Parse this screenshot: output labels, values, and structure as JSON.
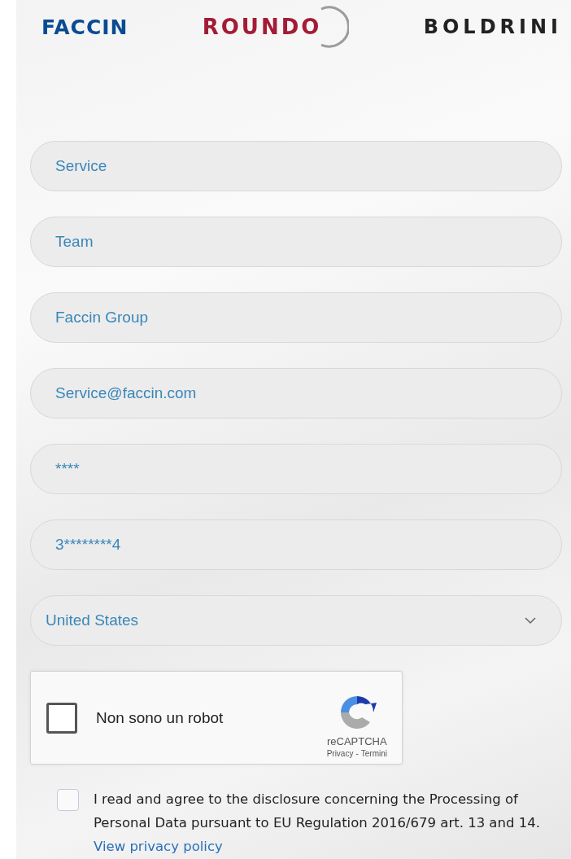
{
  "header": {
    "logos": [
      "FACCIN",
      "ROUNDO",
      "BOLDRINI"
    ]
  },
  "fields": [
    {
      "kind": "text",
      "value": "Service"
    },
    {
      "kind": "text",
      "value": "Team"
    },
    {
      "kind": "text",
      "value": "Faccin Group"
    },
    {
      "kind": "text",
      "value": "Service@faccin.com"
    },
    {
      "kind": "text",
      "value": "****"
    },
    {
      "kind": "text",
      "value": "3********4"
    },
    {
      "kind": "select",
      "value": "United States"
    }
  ],
  "captcha": {
    "label": "Non sono un robot",
    "checked": false,
    "brand": "reCAPTCHA",
    "links": [
      "Privacy",
      "Termini"
    ],
    "separator": "-"
  },
  "consent": {
    "checked": false,
    "text": "I read and agree to the disclosure concerning the Processing of Personal Data pursuant to EU Regulation 2016/679 art. 13 and 14.",
    "link": "View privacy policy"
  }
}
